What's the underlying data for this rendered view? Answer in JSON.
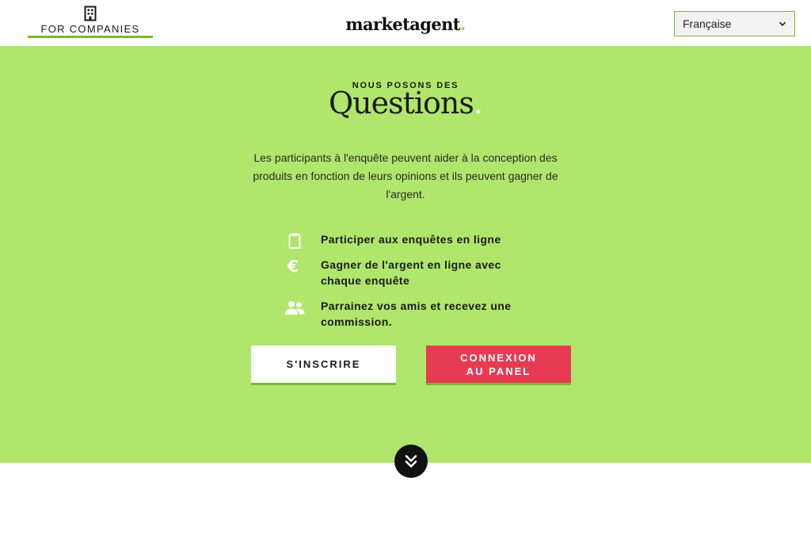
{
  "header": {
    "for_companies_label": "FOR COMPANIES",
    "for_companies_icon": "building-icon",
    "logo_text": "marketagent",
    "logo_dot": ".",
    "language_selected": "Française"
  },
  "hero": {
    "kicker": "NOUS POSONS DES",
    "title": "Questions",
    "title_dot": ".",
    "description": "Les participants à l'enquête peuvent aider à la conception des produits en fonction de leurs opinions et ils peuvent gagner de l'argent.",
    "features": [
      {
        "icon": "clipboard-icon",
        "text": "Participer aux enquêtes en ligne"
      },
      {
        "icon": "euro-icon",
        "text": "Gagner de l'argent en ligne avec chaque enquête"
      },
      {
        "icon": "users-icon",
        "text": "Parrainez vos amis et recevez une commission."
      }
    ],
    "register_label": "S'INSCRIRE",
    "login_label": "CONNEXION\nAU PANEL"
  },
  "colors": {
    "hero_bg": "#b0e66b",
    "accent_green": "#7cb82f",
    "login_red": "#e63b53"
  }
}
